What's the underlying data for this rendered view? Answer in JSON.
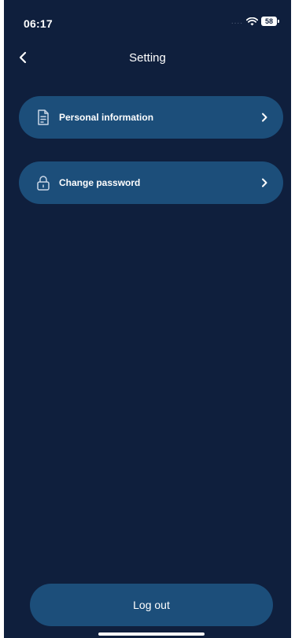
{
  "status_bar": {
    "time": "06:17",
    "signal": "....",
    "battery_level": "58"
  },
  "header": {
    "title": "Setting",
    "back_icon": "chevron-left-icon"
  },
  "menu": {
    "items": [
      {
        "label": "Personal information",
        "icon": "profile-document-icon"
      },
      {
        "label": "Change password",
        "icon": "lock-icon"
      }
    ]
  },
  "footer": {
    "logout_label": "Log out"
  },
  "colors": {
    "background": "#0f1f3d",
    "card": "#1c4e7a",
    "text": "#ffffff"
  }
}
